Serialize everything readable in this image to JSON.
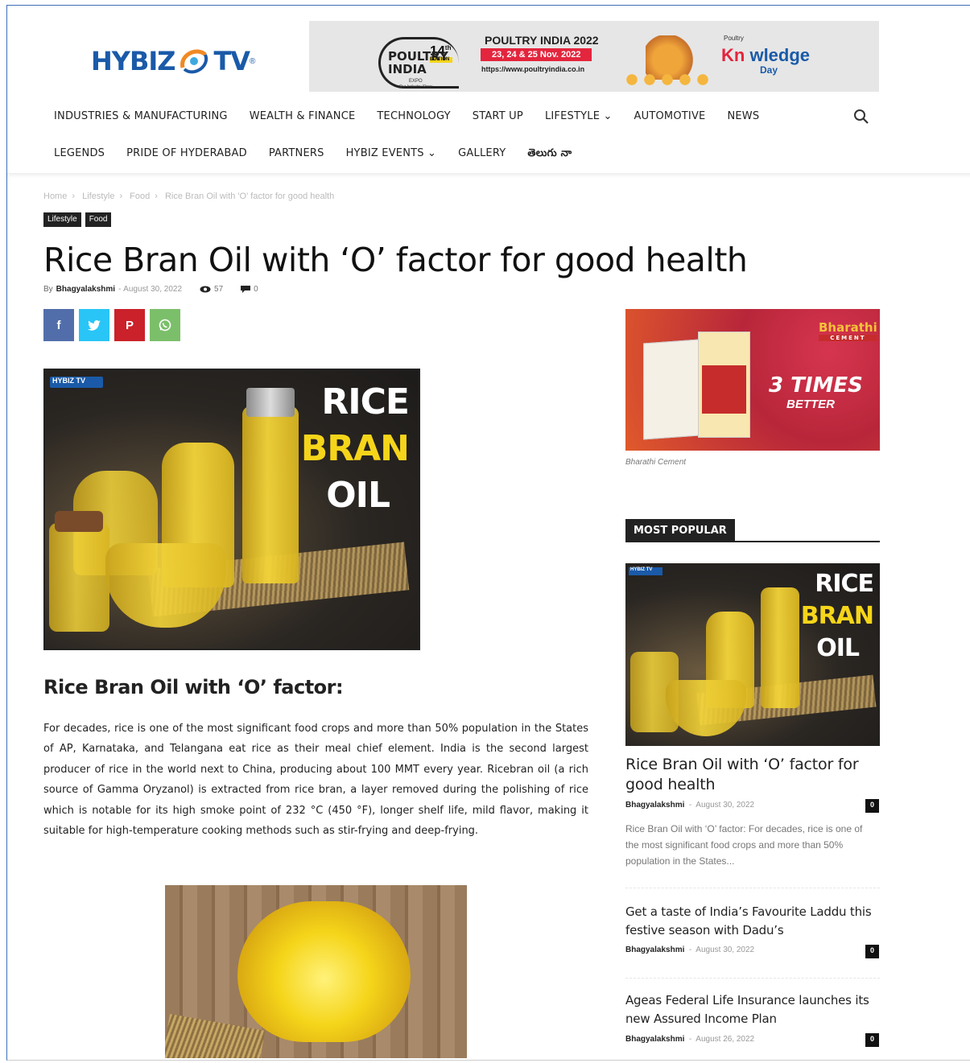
{
  "header": {
    "logo_left": "HYBIZ",
    "logo_right": "TV",
    "logo_reg": "®",
    "banner": {
      "edition_num": "14",
      "edition_sup": "th",
      "edition_word": "EDITION",
      "poultry_logo": "POULTRY INDIA",
      "expo": "EXPO",
      "tagline": "Our Industry Show",
      "title": "POULTRY INDIA 2022",
      "dates": "23, 24 & 25 Nov. 2022",
      "url": "https://www.poultryindia.co.in",
      "kd_small": "Poultry",
      "kd_kn": "Kn",
      "kd_rest": "wledge",
      "kd_day": "Day"
    }
  },
  "nav_row1": [
    "INDUSTRIES & MANUFACTURING",
    "WEALTH & FINANCE",
    "TECHNOLOGY",
    "START UP",
    "LIFESTYLE ⌄",
    "AUTOMOTIVE",
    "NEWS"
  ],
  "nav_row2": [
    "LEGENDS",
    "PRIDE OF HYDERABAD",
    "PARTNERS",
    "HYBIZ EVENTS ⌄",
    "GALLERY",
    "తెలుగు నా"
  ],
  "breadcrumb": [
    "Home",
    "Lifestyle",
    "Food",
    "Rice Bran Oil with 'O' factor for good health"
  ],
  "tags": [
    "Lifestyle",
    "Food"
  ],
  "article": {
    "title": "Rice Bran Oil with ‘O’ factor for good health",
    "by": "By",
    "author": "Bhagyalakshmi",
    "date": "August 30, 2022",
    "views": "57",
    "comments": "0",
    "hero_text": [
      "RICE",
      "BRAN",
      "OIL"
    ],
    "subheading": "Rice Bran Oil with ‘O’ factor:",
    "body": "For decades, rice is one of the most significant food crops and more than 50% population in the States of AP, Karnataka, and Telangana eat rice as their meal chief element. India is the second largest producer of rice in the world next to China, producing about 100 MMT every year. Ricebran oil (a rich source of Gamma Oryzanol) is extracted from rice bran, a layer removed during the polishing of rice which is notable for its high smoke point of 232 °C (450 °F), longer shelf life, mild flavor, making it suitable for high-temperature cooking methods such as stir-frying and deep-frying."
  },
  "share": {
    "facebook": "f",
    "twitter": "t",
    "pinterest": "P",
    "whatsapp": "w"
  },
  "sidebar": {
    "ad_brand": "Bharathi",
    "ad_sub": "CEMENT",
    "ad_times": "3 TIMES",
    "ad_better": "BETTER",
    "ad_caption": "Bharathi Cement",
    "most_popular": "MOST POPULAR",
    "posts": [
      {
        "title": "Rice Bran Oil with ‘O’ factor for good health",
        "author": "Bhagyalakshmi",
        "date": "August 30, 2022",
        "comments": "0",
        "excerpt": "Rice Bran Oil with ‘O’ factor: For decades, rice is one of the most significant food crops and more than 50% population in the States..."
      },
      {
        "title": "Get a taste of India’s Favourite Laddu this festive season with Dadu’s",
        "author": "Bhagyalakshmi",
        "date": "August 30, 2022",
        "comments": "0"
      },
      {
        "title": "Ageas Federal Life Insurance launches its new Assured Income Plan",
        "author": "Bhagyalakshmi",
        "date": "August 26, 2022",
        "comments": "0"
      }
    ]
  },
  "colors": {
    "brand_blue": "#1a5aa8",
    "facebook": "#516eab",
    "twitter": "#29c5f6",
    "pinterest": "#ca212a",
    "whatsapp": "#7bbf6a",
    "accent_yellow": "#f5d51a"
  }
}
